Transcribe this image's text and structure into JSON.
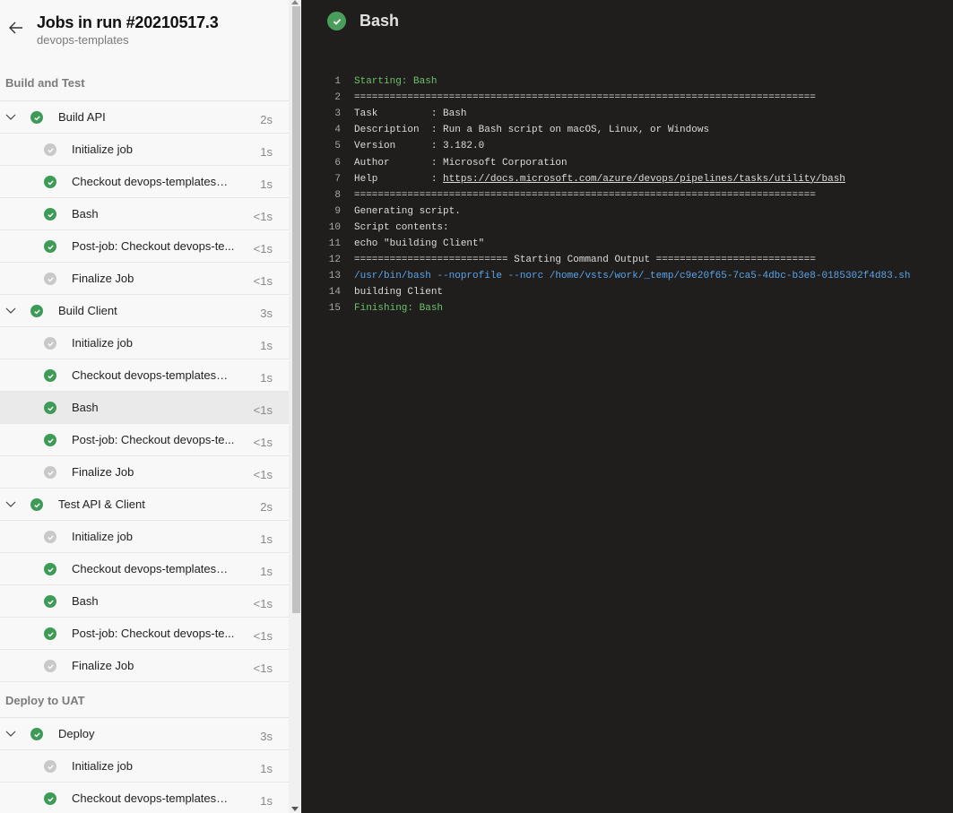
{
  "header": {
    "title": "Jobs in run #20210517.3",
    "subtitle": "devops-templates"
  },
  "stages": [
    {
      "name": "Build and Test",
      "jobs": [
        {
          "name": "Build API",
          "duration": "2s",
          "status": "succeeded",
          "tasks": [
            {
              "name": "Initialize job",
              "duration": "1s",
              "status": "skipped"
            },
            {
              "name": "Checkout devops-templates@...",
              "duration": "1s",
              "status": "succeeded"
            },
            {
              "name": "Bash",
              "duration": "<1s",
              "status": "succeeded"
            },
            {
              "name": "Post-job: Checkout devops-te...",
              "duration": "<1s",
              "status": "succeeded"
            },
            {
              "name": "Finalize Job",
              "duration": "<1s",
              "status": "skipped"
            }
          ]
        },
        {
          "name": "Build Client",
          "duration": "3s",
          "status": "succeeded",
          "tasks": [
            {
              "name": "Initialize job",
              "duration": "1s",
              "status": "skipped"
            },
            {
              "name": "Checkout devops-templates@...",
              "duration": "1s",
              "status": "succeeded"
            },
            {
              "name": "Bash",
              "duration": "<1s",
              "status": "succeeded",
              "selected": true
            },
            {
              "name": "Post-job: Checkout devops-te...",
              "duration": "<1s",
              "status": "succeeded"
            },
            {
              "name": "Finalize Job",
              "duration": "<1s",
              "status": "skipped"
            }
          ]
        },
        {
          "name": "Test API & Client",
          "duration": "2s",
          "status": "succeeded",
          "tasks": [
            {
              "name": "Initialize job",
              "duration": "1s",
              "status": "skipped"
            },
            {
              "name": "Checkout devops-templates@...",
              "duration": "1s",
              "status": "succeeded"
            },
            {
              "name": "Bash",
              "duration": "<1s",
              "status": "succeeded"
            },
            {
              "name": "Post-job: Checkout devops-te...",
              "duration": "<1s",
              "status": "succeeded"
            },
            {
              "name": "Finalize Job",
              "duration": "<1s",
              "status": "skipped"
            }
          ]
        }
      ]
    },
    {
      "name": "Deploy to UAT",
      "jobs": [
        {
          "name": "Deploy",
          "duration": "3s",
          "status": "succeeded",
          "tasks": [
            {
              "name": "Initialize job",
              "duration": "1s",
              "status": "skipped"
            },
            {
              "name": "Checkout devops-templates@...",
              "duration": "1s",
              "status": "succeeded"
            }
          ]
        }
      ]
    }
  ],
  "log": {
    "title": "Bash",
    "status": "succeeded",
    "lines": [
      {
        "n": "1",
        "text": "Starting: Bash",
        "style": "green"
      },
      {
        "n": "2",
        "text": "==============================================================================",
        "style": ""
      },
      {
        "n": "3",
        "text": "Task         : Bash",
        "style": ""
      },
      {
        "n": "4",
        "text": "Description  : Run a Bash script on macOS, Linux, or Windows",
        "style": ""
      },
      {
        "n": "5",
        "text": "Version      : 3.182.0",
        "style": ""
      },
      {
        "n": "6",
        "text": "Author       : Microsoft Corporation",
        "style": ""
      },
      {
        "n": "7",
        "text": "Help         : ",
        "link": "https://docs.microsoft.com/azure/devops/pipelines/tasks/utility/bash",
        "style": ""
      },
      {
        "n": "8",
        "text": "==============================================================================",
        "style": ""
      },
      {
        "n": "9",
        "text": "Generating script.",
        "style": ""
      },
      {
        "n": "10",
        "text": "Script contents:",
        "style": ""
      },
      {
        "n": "11",
        "text": "echo \"building Client\"",
        "style": ""
      },
      {
        "n": "12",
        "text": "========================== Starting Command Output ===========================",
        "style": ""
      },
      {
        "n": "13",
        "text": "/usr/bin/bash --noprofile --norc /home/vsts/work/_temp/c9e20f65-7ca5-4dbc-b3e8-0185302f4d83.sh",
        "style": "blue"
      },
      {
        "n": "14",
        "text": "building Client",
        "style": ""
      },
      {
        "n": "15",
        "text": "Finishing: Bash",
        "style": "green"
      }
    ]
  },
  "colors": {
    "success": "#3e9b57",
    "skipped": "#c9c9c9",
    "log_bg": "#1f1e1d",
    "log_green": "#6cc16b",
    "log_blue": "#5aa3e8"
  }
}
